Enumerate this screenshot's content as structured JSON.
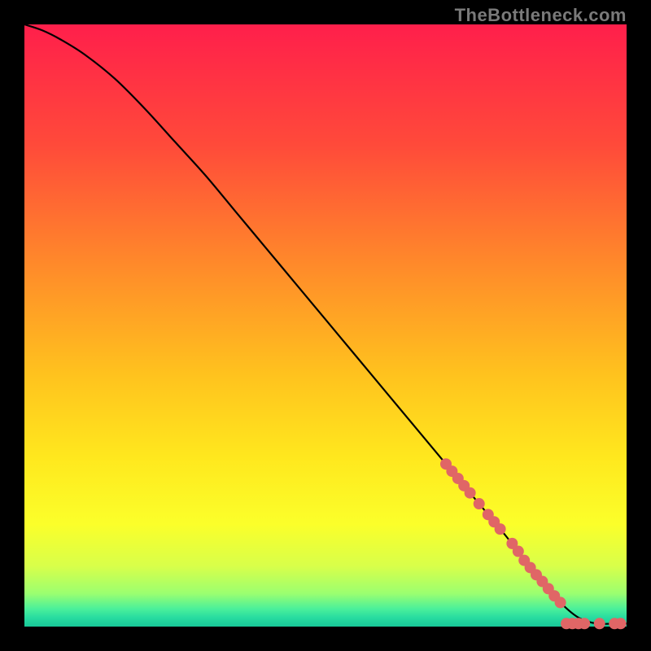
{
  "watermark": "TheBottleneck.com",
  "colors": {
    "gradient_stops": [
      {
        "offset": 0.0,
        "color": "#ff1f4b"
      },
      {
        "offset": 0.2,
        "color": "#ff4a3a"
      },
      {
        "offset": 0.4,
        "color": "#ff8a2a"
      },
      {
        "offset": 0.58,
        "color": "#ffc21e"
      },
      {
        "offset": 0.72,
        "color": "#ffe81e"
      },
      {
        "offset": 0.83,
        "color": "#fbff2a"
      },
      {
        "offset": 0.9,
        "color": "#d8ff4a"
      },
      {
        "offset": 0.945,
        "color": "#9bff70"
      },
      {
        "offset": 0.97,
        "color": "#4cf09a"
      },
      {
        "offset": 0.985,
        "color": "#28dca0"
      },
      {
        "offset": 1.0,
        "color": "#18c898"
      }
    ],
    "marker_fill": "#e06666",
    "marker_stroke": "#b24a4a",
    "curve_stroke": "#000000"
  },
  "chart_data": {
    "type": "line",
    "title": "",
    "xlabel": "",
    "ylabel": "",
    "xlim": [
      0,
      100
    ],
    "ylim": [
      0,
      100
    ],
    "grid": false,
    "legend": false,
    "series": [
      {
        "name": "bottleneck-curve",
        "x": [
          0,
          3,
          6,
          10,
          15,
          20,
          25,
          30,
          35,
          40,
          45,
          50,
          55,
          60,
          65,
          70,
          75,
          80,
          83,
          86,
          89,
          92,
          95,
          98,
          100
        ],
        "y": [
          100,
          99,
          97.5,
          95,
          91,
          86,
          80.5,
          75,
          69,
          63,
          57,
          51,
          45,
          39,
          33,
          27,
          21,
          15,
          11,
          7.5,
          4,
          1.5,
          0.5,
          0.5,
          0.5
        ]
      }
    ],
    "markers": {
      "name": "highlighted-points",
      "color": "#e06666",
      "points": [
        {
          "x": 70.0,
          "y": 27.0
        },
        {
          "x": 71.0,
          "y": 25.8
        },
        {
          "x": 72.0,
          "y": 24.6
        },
        {
          "x": 73.0,
          "y": 23.4
        },
        {
          "x": 74.0,
          "y": 22.2
        },
        {
          "x": 75.5,
          "y": 20.4
        },
        {
          "x": 77.0,
          "y": 18.6
        },
        {
          "x": 78.0,
          "y": 17.4
        },
        {
          "x": 79.0,
          "y": 16.2
        },
        {
          "x": 81.0,
          "y": 13.8
        },
        {
          "x": 82.0,
          "y": 12.5
        },
        {
          "x": 83.0,
          "y": 11.0
        },
        {
          "x": 84.0,
          "y": 9.8
        },
        {
          "x": 85.0,
          "y": 8.6
        },
        {
          "x": 86.0,
          "y": 7.5
        },
        {
          "x": 87.0,
          "y": 6.3
        },
        {
          "x": 88.0,
          "y": 5.1
        },
        {
          "x": 89.0,
          "y": 4.0
        },
        {
          "x": 90.0,
          "y": 0.5
        },
        {
          "x": 91.0,
          "y": 0.5
        },
        {
          "x": 92.0,
          "y": 0.5
        },
        {
          "x": 93.0,
          "y": 0.5
        },
        {
          "x": 95.5,
          "y": 0.5
        },
        {
          "x": 98.0,
          "y": 0.5
        },
        {
          "x": 99.0,
          "y": 0.5
        }
      ]
    }
  }
}
